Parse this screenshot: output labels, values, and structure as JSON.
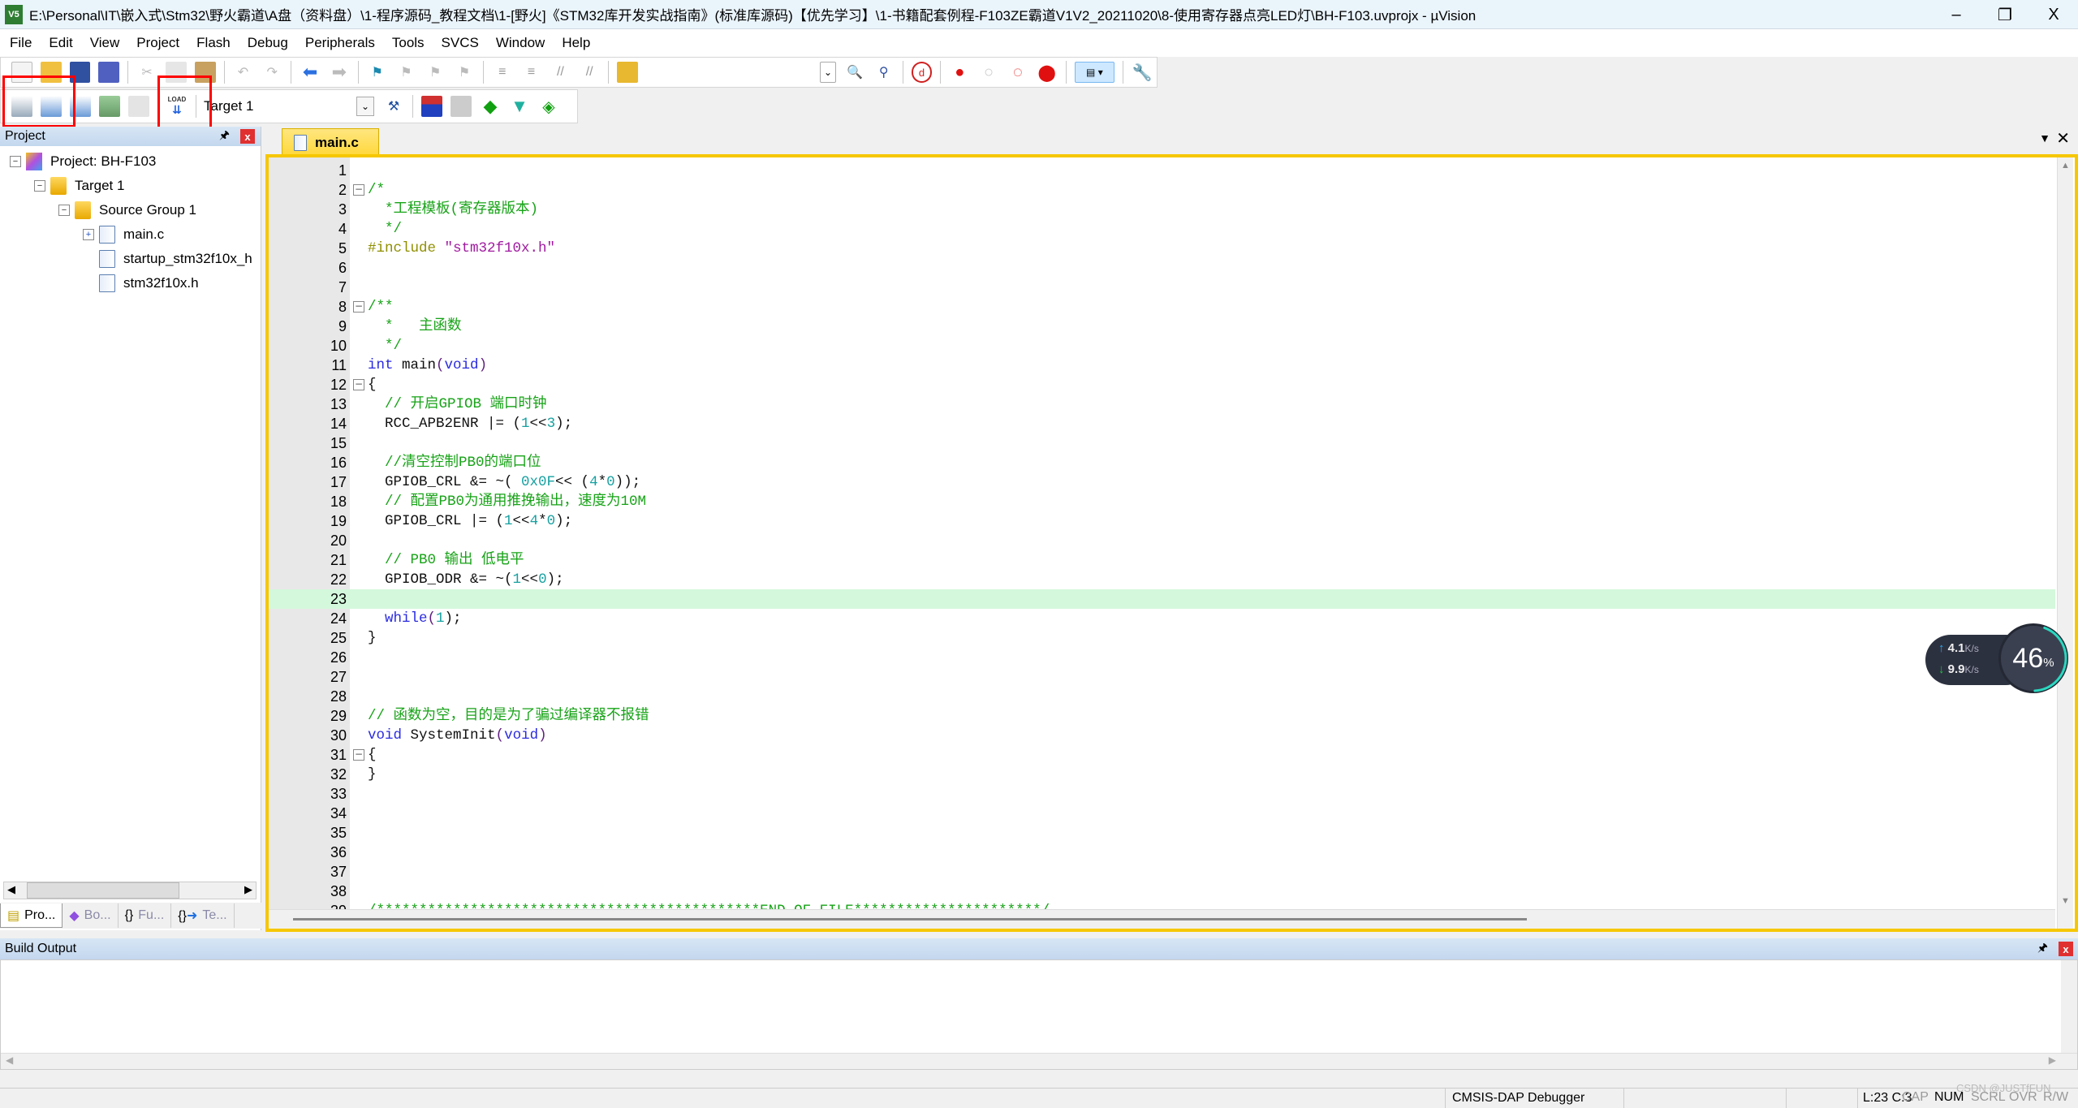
{
  "window": {
    "title": "E:\\Personal\\IT\\嵌入式\\Stm32\\野火霸道\\A盘（资料盘）\\1-程序源码_教程文档\\1-[野火]《STM32库开发实战指南》(标准库源码)【优先学习】\\1-书籍配套例程-F103ZE霸道V1V2_20211020\\8-使用寄存器点亮LED灯\\BH-F103.uvprojx - µVision",
    "icon": "V5",
    "minimize": "–",
    "restore": "❐",
    "close": "X"
  },
  "menu": [
    {
      "label": "File"
    },
    {
      "label": "Edit"
    },
    {
      "label": "View"
    },
    {
      "label": "Project"
    },
    {
      "label": "Flash"
    },
    {
      "label": "Debug"
    },
    {
      "label": "Peripherals"
    },
    {
      "label": "Tools"
    },
    {
      "label": "SVCS"
    },
    {
      "label": "Window"
    },
    {
      "label": "Help"
    }
  ],
  "build_toolbar": {
    "target": "Target 1",
    "load_label": "LOAD"
  },
  "project_panel": {
    "title": "Project",
    "pin": "🖈",
    "close": "x",
    "tree": [
      {
        "label": "Project: BH-F103"
      },
      {
        "label": "Target 1"
      },
      {
        "label": "Source Group 1"
      },
      {
        "label": "main.c"
      },
      {
        "label": "startup_stm32f10x_h"
      },
      {
        "label": "stm32f10x.h"
      }
    ],
    "tabs": [
      {
        "label": "Pro..."
      },
      {
        "label": "Bo..."
      },
      {
        "label": "Fu..."
      },
      {
        "label": "Te..."
      }
    ]
  },
  "editor": {
    "tab": "main.c",
    "cursor_line": 23,
    "lines": [
      [],
      [
        [
          "/*",
          "cm"
        ]
      ],
      [
        [
          "  *工程模板(寄存器版本)",
          "cm"
        ]
      ],
      [
        [
          "  */",
          "cm"
        ]
      ],
      [
        [
          "#include ",
          "pp"
        ],
        [
          "\"stm32f10x.h\"",
          "str"
        ]
      ],
      [],
      [],
      [
        [
          "/**",
          "cm"
        ]
      ],
      [
        [
          "  *   主函数",
          "cm"
        ]
      ],
      [
        [
          "  */",
          "cm"
        ]
      ],
      [
        [
          "int ",
          "kw"
        ],
        [
          "main",
          "tx"
        ],
        [
          "(",
          "pn"
        ],
        [
          "void",
          "kw"
        ],
        [
          ")",
          "pn"
        ]
      ],
      [
        [
          "{",
          "tx"
        ]
      ],
      [
        [
          "  // 开启GPIOB 端口时钟",
          "cm"
        ]
      ],
      [
        [
          "  RCC_APB2ENR |= (",
          "tx"
        ],
        [
          "1",
          "num"
        ],
        [
          "<<",
          "tx"
        ],
        [
          "3",
          "num"
        ],
        [
          ");",
          "tx"
        ]
      ],
      [],
      [
        [
          "  //清空控制PB0的端口位",
          "cm"
        ]
      ],
      [
        [
          "  GPIOB_CRL &= ~( ",
          "tx"
        ],
        [
          "0x0F",
          "num"
        ],
        [
          "<< (",
          "tx"
        ],
        [
          "4",
          "num"
        ],
        [
          "*",
          "tx"
        ],
        [
          "0",
          "num"
        ],
        [
          "));",
          "tx"
        ]
      ],
      [
        [
          "  // 配置PB0为通用推挽输出，速度为10M",
          "cm"
        ]
      ],
      [
        [
          "  GPIOB_CRL |= (",
          "tx"
        ],
        [
          "1",
          "num"
        ],
        [
          "<<",
          "tx"
        ],
        [
          "4",
          "num"
        ],
        [
          "*",
          "tx"
        ],
        [
          "0",
          "num"
        ],
        [
          ");",
          "tx"
        ]
      ],
      [],
      [
        [
          "  // PB0 输出 低电平",
          "cm"
        ]
      ],
      [
        [
          "  GPIOB_ODR &= ~(",
          "tx"
        ],
        [
          "1",
          "num"
        ],
        [
          "<<",
          "tx"
        ],
        [
          "0",
          "num"
        ],
        [
          ");",
          "tx"
        ]
      ],
      [],
      [
        [
          "  while",
          "kw"
        ],
        [
          "(",
          "pn"
        ],
        [
          "1",
          "num"
        ],
        [
          ");",
          "tx"
        ]
      ],
      [
        [
          "}",
          "tx"
        ]
      ],
      [],
      [],
      [],
      [
        [
          "// 函数为空，目的是为了骗过编译器不报错",
          "cm"
        ]
      ],
      [
        [
          "void ",
          "kw"
        ],
        [
          "SystemInit",
          "tx"
        ],
        [
          "(",
          "pn"
        ],
        [
          "void",
          "kw"
        ],
        [
          ")",
          "pn"
        ]
      ],
      [
        [
          "{",
          "tx"
        ]
      ],
      [
        [
          "}",
          "tx"
        ]
      ],
      [],
      [],
      [],
      [],
      [],
      [],
      [
        [
          "/*********************************************END OF FILE**********************/",
          "cm"
        ]
      ]
    ],
    "folds": {
      "2": "−",
      "8": "−",
      "12": "−",
      "31": "−"
    }
  },
  "build_output": {
    "title": "Build Output"
  },
  "status": {
    "debugger": "CMSIS-DAP Debugger",
    "position": "L:23 C:3",
    "cap": "CAP",
    "num": "NUM",
    "scrl": "SCRL",
    "ovr": "OVR",
    "rw": "R/W",
    "watermark": "CSDN @JUSTfFUN"
  },
  "net_widget": {
    "upload": "4.1",
    "download": "9.9",
    "unit": "K/s",
    "percent": "46",
    "percent_sign": "%",
    "load_fraction": 0.46,
    "colors": {
      "up": "#2aa8f0",
      "down": "#22c040",
      "ring": "#2ad8c0"
    }
  }
}
